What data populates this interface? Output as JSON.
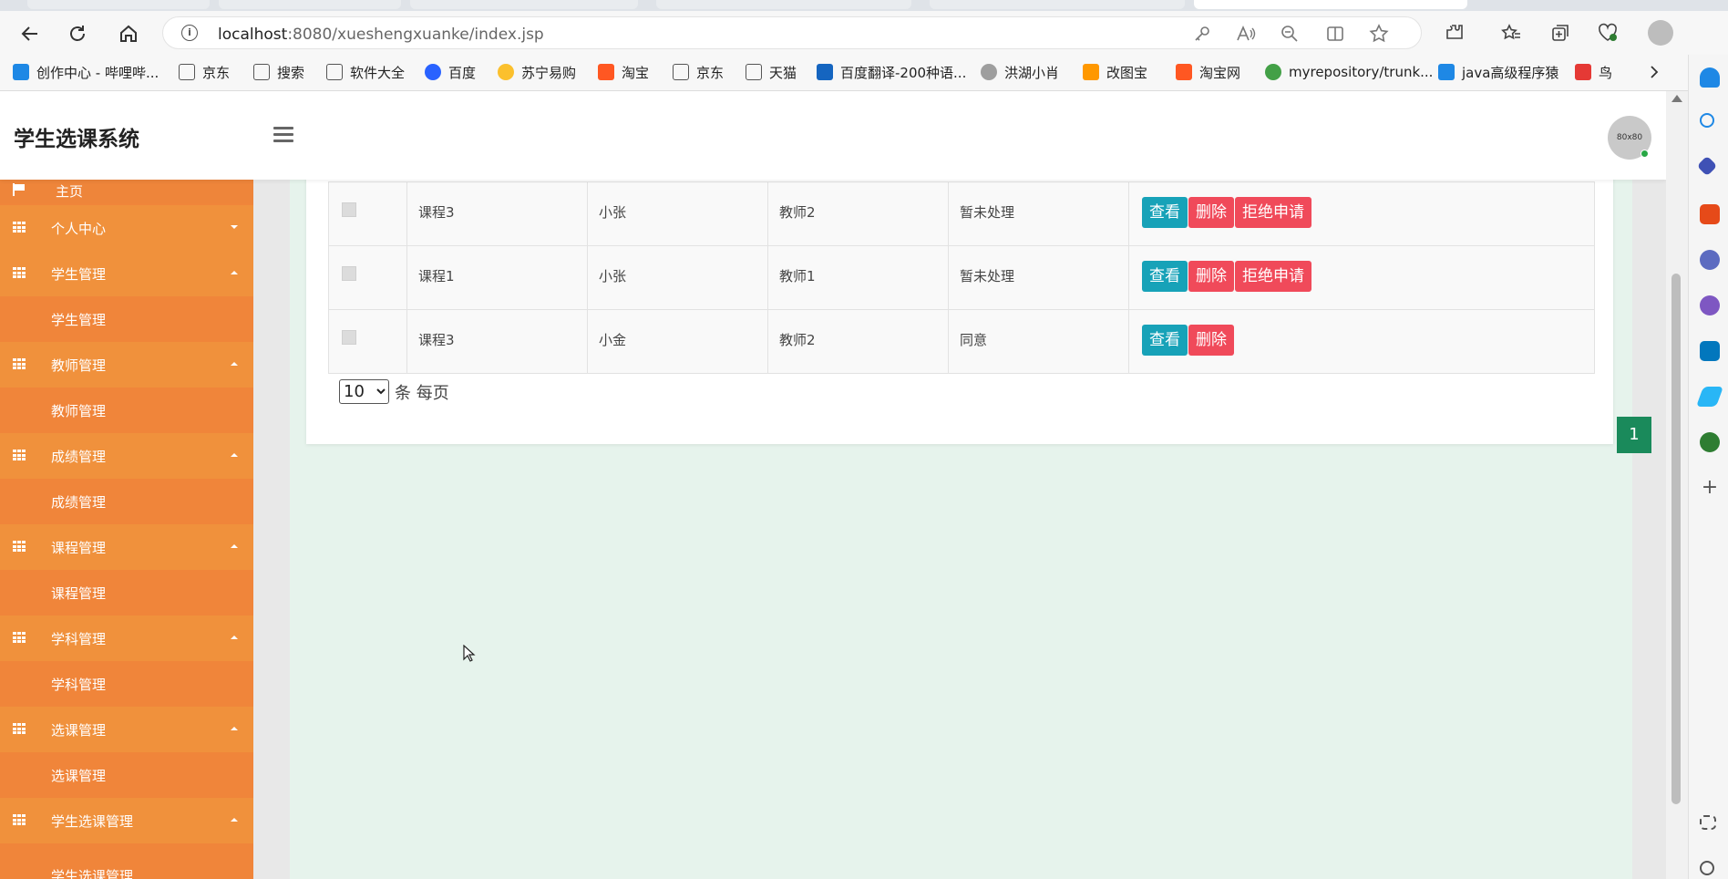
{
  "browser": {
    "url_host": "localhost",
    "url_rest": ":8080/xueshengxuanke/index.jsp",
    "bookmarks": [
      {
        "label": "创作中心 - 哔哩哔...",
        "color": "#1e88e5"
      },
      {
        "label": "京东",
        "color": "#ffffff"
      },
      {
        "label": "搜索",
        "color": "#ffffff"
      },
      {
        "label": "软件大全",
        "color": "#ffffff"
      },
      {
        "label": "百度",
        "color": "#2962ff"
      },
      {
        "label": "苏宁易购",
        "color": "#fbc02d"
      },
      {
        "label": "淘宝",
        "color": "#ff5722"
      },
      {
        "label": "京东",
        "color": "#ffffff"
      },
      {
        "label": "天猫",
        "color": "#ffffff"
      },
      {
        "label": "百度翻译-200种语...",
        "color": "#1565c0"
      },
      {
        "label": "洪湖小肖",
        "color": "#9e9e9e"
      },
      {
        "label": "改图宝",
        "color": "#ff9800"
      },
      {
        "label": "淘宝网",
        "color": "#ff5722"
      },
      {
        "label": "myrepository/trunk...",
        "color": "#43a047"
      },
      {
        "label": "java高级程序猿",
        "color": "#1e88e5"
      },
      {
        "label": "鸟",
        "color": "#e53935"
      }
    ]
  },
  "app": {
    "brand": "学生选课系统",
    "avatar_text": "80x80"
  },
  "sidebar": {
    "home": "主页",
    "groups": [
      {
        "label": "个人中心",
        "caret": "down",
        "sub": null
      },
      {
        "label": "学生管理",
        "caret": "up",
        "sub": "学生管理"
      },
      {
        "label": "教师管理",
        "caret": "up",
        "sub": "教师管理"
      },
      {
        "label": "成绩管理",
        "caret": "up",
        "sub": "成绩管理"
      },
      {
        "label": "课程管理",
        "caret": "up",
        "sub": "课程管理"
      },
      {
        "label": "学科管理",
        "caret": "up",
        "sub": "学科管理"
      },
      {
        "label": "选课管理",
        "caret": "up",
        "sub": "选课管理"
      },
      {
        "label": "学生选课管理",
        "caret": "up",
        "sub": "学生选课管理"
      }
    ]
  },
  "table": {
    "rows": [
      {
        "course": "课程3",
        "student": "小张",
        "teacher": "教师2",
        "status": "暂未处理",
        "actions": [
          "查看",
          "删除",
          "拒绝申请"
        ]
      },
      {
        "course": "课程1",
        "student": "小张",
        "teacher": "教师1",
        "status": "暂未处理",
        "actions": [
          "查看",
          "删除",
          "拒绝申请"
        ]
      },
      {
        "course": "课程3",
        "student": "小金",
        "teacher": "教师2",
        "status": "同意",
        "actions": [
          "查看",
          "删除"
        ]
      }
    ]
  },
  "pager": {
    "page_size": "10",
    "per_page_text": "条 每页",
    "current_page": "1"
  }
}
